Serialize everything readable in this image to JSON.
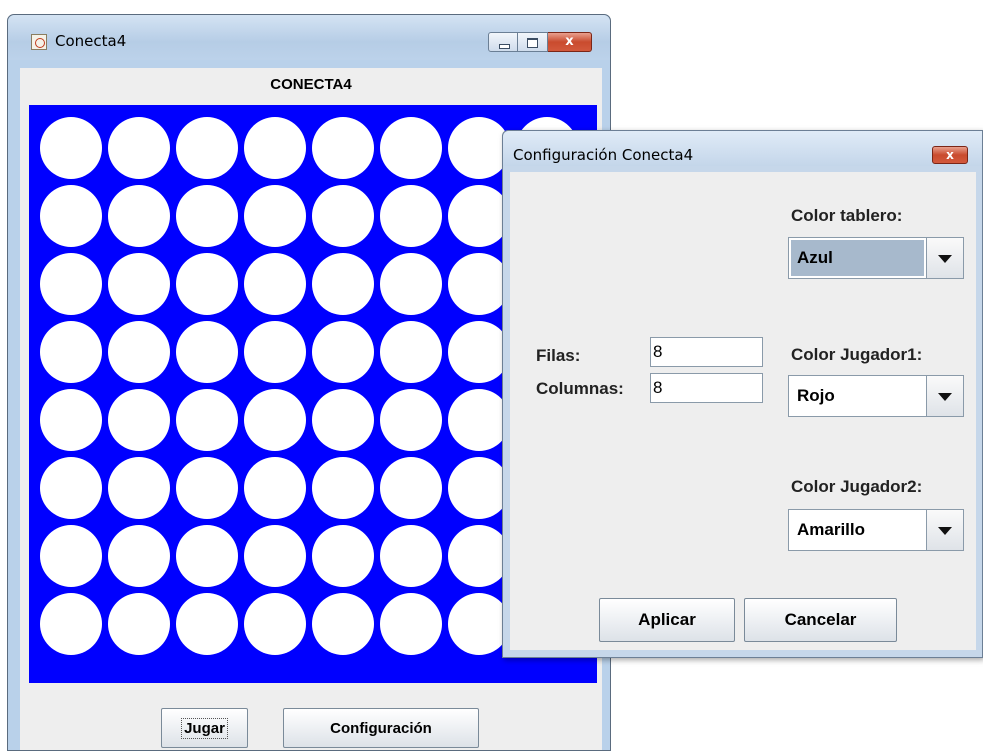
{
  "main_window": {
    "title": "Conecta4",
    "heading": "CONECTA4",
    "board": {
      "rows": 8,
      "columns": 8,
      "board_color": "#0000ff",
      "empty_color": "#ffffff"
    },
    "buttons": {
      "play": "Jugar",
      "config": "Configuración"
    },
    "controls": {
      "close": "x"
    }
  },
  "dialog": {
    "title": "Configuración Conecta4",
    "close_glyph": "x",
    "rows_label": "Filas:",
    "rows_value": "8",
    "columns_label": "Columnas:",
    "columns_value": "8",
    "board_color_label": "Color tablero:",
    "board_color_value": "Azul",
    "player1_label": "Color Jugador1:",
    "player1_value": "Rojo",
    "player2_label": "Color Jugador2:",
    "player2_value": "Amarillo",
    "apply_label": "Aplicar",
    "cancel_label": "Cancelar"
  }
}
